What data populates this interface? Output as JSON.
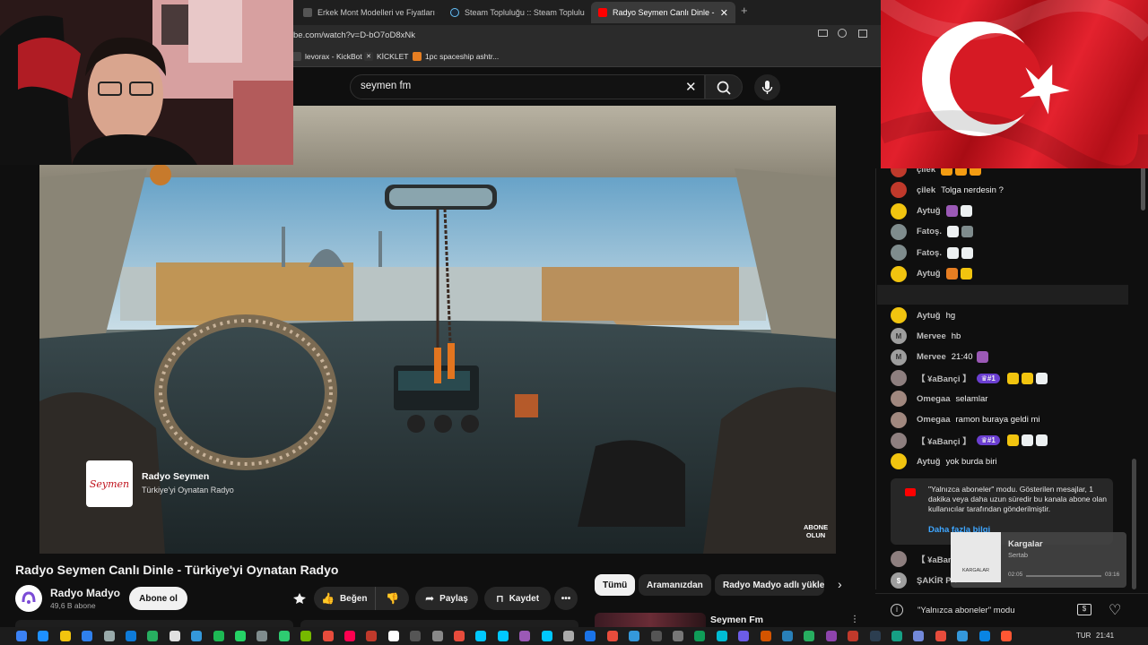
{
  "browser": {
    "tabs": [
      {
        "label": "Erkek Mont Modelleri ve Fiyatları - Fl",
        "active": false
      },
      {
        "label": "Steam Topluluğu :: Steam Topluluk Pa",
        "active": false
      },
      {
        "label": "Radyo Seymen Canlı Dinle - Türk",
        "active": true
      }
    ],
    "new_tab": "+",
    "url": "be.com/watch?v=D-bO7oD8xNk",
    "bookmarks": [
      "levorax - KickBot",
      "KİCKLET",
      "1pc spaceship ashtr..."
    ]
  },
  "yt": {
    "search_value": "seymen fm"
  },
  "video": {
    "channel_card_name": "Radyo Seymen",
    "channel_card_sub": "Türkiye'yi Oynatan Radyo",
    "logo_text": "Seymen",
    "subscribe_watermark_1": "ABONE",
    "subscribe_watermark_2": "OLUN"
  },
  "below": {
    "title": "Radyo Seymen Canlı Dinle - Türkiye'yi Oynatan Radyo",
    "channel_name": "Radyo Madyo",
    "subscribers": "49,6 B abone",
    "subscribe_label": "Abone ol",
    "like_label": "Beğen",
    "share_label": "Paylaş",
    "save_label": "Kaydet",
    "chips": [
      "Tümü",
      "Aramanızdan",
      "Radyo Madyo adlı yükle"
    ],
    "related_title": "Seymen Fm"
  },
  "chat": {
    "messages": [
      {
        "author": "çilek",
        "text": "",
        "av": "#c0392b"
      },
      {
        "author": "çilek",
        "text": "Tolga nerdesin ?",
        "av": "#c0392b"
      },
      {
        "author": "Aytuğ",
        "text": "",
        "av": "#f1c40f"
      },
      {
        "author": "Fatoş.",
        "text": "",
        "av": "#7f8c8d"
      },
      {
        "author": "Fatoş.",
        "text": "",
        "av": "#7f8c8d"
      },
      {
        "author": "Aytuğ",
        "text": "",
        "av": "#f1c40f"
      },
      {
        "author": "Mervee",
        "text": "",
        "av": "#9e9e9e"
      },
      {
        "author": "Aytuğ",
        "text": "hg",
        "av": "#f1c40f"
      },
      {
        "author": "Mervee",
        "text": "hb",
        "av": "#9e9e9e"
      },
      {
        "author": "Mervee",
        "text": "21:40",
        "av": "#9e9e9e"
      },
      {
        "author": "【 ¥aBançi 】",
        "text": "",
        "av": "#8e7f7f"
      },
      {
        "author": "Omegaa",
        "text": "selamlar",
        "av": "#a1887f"
      },
      {
        "author": "Omegaa",
        "text": "ramon buraya geldi mi",
        "av": "#a1887f"
      },
      {
        "author": "【 ¥aBançi 】",
        "text": "",
        "av": "#8e7f7f"
      },
      {
        "author": "Aytuğ",
        "text": "yok burda biri",
        "av": "#f1c40f"
      }
    ],
    "member_badge": "#1",
    "notice_title": "\"Yalnızca aboneler\" modu. Gösterilen mesajlar, 1 dakika veya daha uzun süredir bu kanala abone olan kullanıcılar tarafından gönderilmiştir.",
    "notice_link": "Daha fazla bilgi",
    "bottom_rows": [
      {
        "author": "【 ¥aBan",
        "av": "#8e7f7f"
      },
      {
        "author": "ŞAKİR PA",
        "av": "#9e9e9e"
      }
    ],
    "input_text": "\"Yalnızca aboneler\" modu",
    "mini_player_title": "Kargalar",
    "mini_player_artist": "Sertab",
    "mini_cover_text": "KARGALAR",
    "mini_time_left": "02:05",
    "mini_time_right": "03:16"
  },
  "taskbar": {
    "lang": "TUR",
    "time": "21:41"
  }
}
